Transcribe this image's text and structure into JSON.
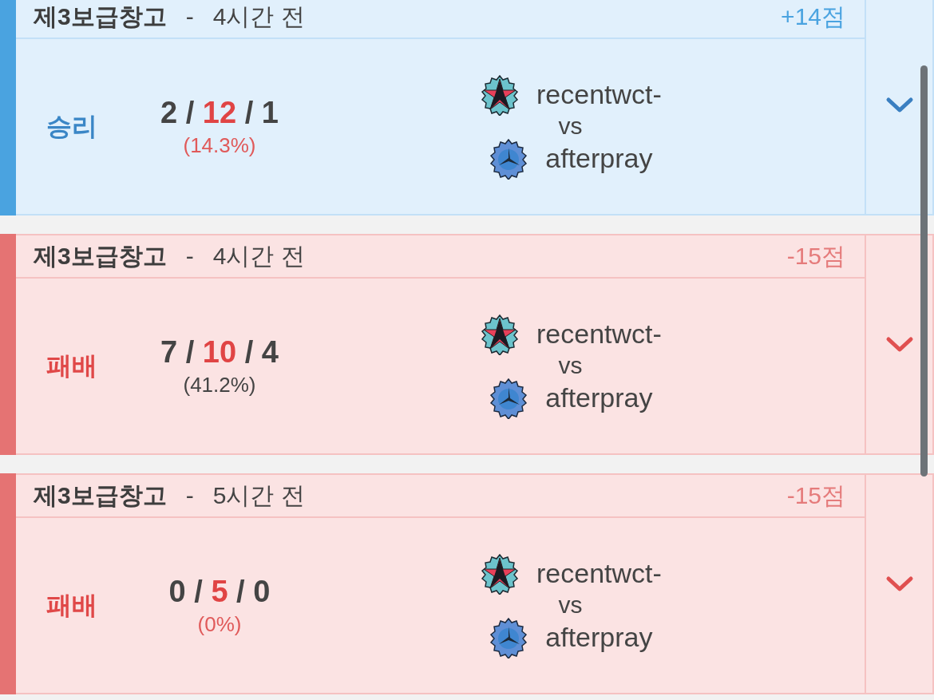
{
  "matches": [
    {
      "kind": "win",
      "selected": false,
      "map": "제3보급창고",
      "separator": "-",
      "time": "4시간 전",
      "points": "+14점",
      "result_label": "승리",
      "kda": [
        "2",
        "12",
        "1"
      ],
      "kda_separator": "/",
      "ratio": "(14.3%)",
      "ratio_highlight": true,
      "players": [
        {
          "name": "recentwct-",
          "kind": "star"
        },
        {
          "name": "afterpray",
          "kind": "propeller"
        }
      ],
      "versus": "vs"
    },
    {
      "kind": "loss",
      "selected": false,
      "map": "제3보급창고",
      "separator": "-",
      "time": "4시간 전",
      "points": "-15점",
      "result_label": "패배",
      "kda": [
        "7",
        "10",
        "4"
      ],
      "kda_separator": "/",
      "ratio": "(41.2%)",
      "ratio_highlight": false,
      "players": [
        {
          "name": "recentwct-",
          "kind": "star"
        },
        {
          "name": "afterpray",
          "kind": "propeller"
        }
      ],
      "versus": "vs"
    },
    {
      "kind": "loss",
      "selected": false,
      "map": "제3보급창고",
      "separator": "-",
      "time": "5시간 전",
      "points": "-15점",
      "result_label": "패배",
      "kda": [
        "0",
        "5",
        "0"
      ],
      "kda_separator": "/",
      "ratio": "(0%)",
      "ratio_highlight": true,
      "players": [
        {
          "name": "recentwct-",
          "kind": "star"
        },
        {
          "name": "afterpray",
          "kind": "propeller"
        }
      ],
      "versus": "vs"
    }
  ]
}
